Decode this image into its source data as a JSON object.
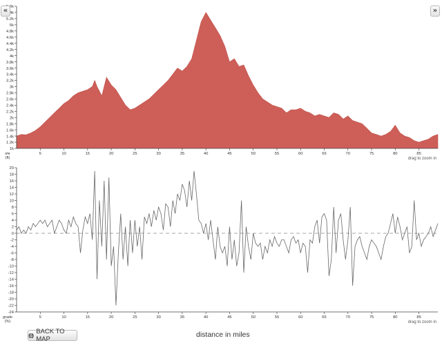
{
  "ui": {
    "collapse_left_label": "«",
    "collapse_right_label": "»",
    "back_to_map_label": "BACK TO MAP",
    "back_to_map_icon": "globe-icon",
    "x_axis_label": "distance in miles"
  },
  "chart_data": [
    {
      "type": "area",
      "ylabel_lines": [
        "ele",
        "(ft)"
      ],
      "hint": "drag to zoom in",
      "color": "#cd5f58",
      "xlim": [
        0,
        89
      ],
      "ylim": [
        1000,
        5600
      ],
      "x_ticks": [
        5,
        10,
        15,
        20,
        25,
        30,
        35,
        40,
        45,
        50,
        55,
        60,
        65,
        70,
        75,
        80,
        85
      ],
      "y_ticks": [
        1000,
        1200,
        1400,
        1600,
        1800,
        2000,
        2200,
        2400,
        2600,
        2800,
        3000,
        3200,
        3400,
        3600,
        3800,
        4000,
        4200,
        4400,
        4600,
        4800,
        5000,
        5200,
        5400,
        5600
      ],
      "y_tick_labels": [
        "1k",
        "1.2k",
        "1.4k",
        "1.6k",
        "1.8k",
        "2k",
        "2.2k",
        "2.4k",
        "2.6k",
        "2.8k",
        "3k",
        "3.2k",
        "3.4k",
        "3.6k",
        "3.8k",
        "4k",
        "4.2k",
        "4.4k",
        "4.6k",
        "4.8k",
        "5k",
        "5.2k",
        "5.4k",
        "5.6k"
      ],
      "x": [
        0,
        1,
        2,
        3,
        4,
        5,
        6,
        7,
        8,
        9,
        10,
        11,
        12,
        13,
        14,
        15,
        16,
        16.5,
        17,
        18,
        19,
        20,
        21,
        22,
        23,
        24,
        25,
        26,
        27,
        28,
        29,
        30,
        31,
        32,
        33,
        34,
        35,
        36,
        37,
        38,
        39,
        40,
        41,
        42,
        43,
        44,
        45,
        46,
        47,
        48,
        49,
        50,
        51,
        52,
        53,
        54,
        55,
        56,
        57,
        58,
        59,
        60,
        61,
        62,
        63,
        64,
        65,
        66,
        67,
        68,
        69,
        70,
        71,
        72,
        73,
        74,
        75,
        76,
        77,
        78,
        79,
        80,
        81,
        82,
        83,
        84,
        85,
        86,
        87,
        88,
        89
      ],
      "y": [
        1400,
        1450,
        1440,
        1500,
        1580,
        1700,
        1850,
        2000,
        2150,
        2300,
        2450,
        2550,
        2700,
        2800,
        2850,
        2900,
        3000,
        3200,
        3000,
        2700,
        3300,
        3050,
        2900,
        2650,
        2400,
        2250,
        2300,
        2400,
        2500,
        2600,
        2750,
        2900,
        3050,
        3200,
        3400,
        3600,
        3500,
        3650,
        3900,
        4500,
        5100,
        5400,
        5150,
        4900,
        4650,
        4300,
        3800,
        3900,
        3650,
        3700,
        3350,
        3050,
        2800,
        2600,
        2500,
        2400,
        2350,
        2300,
        2150,
        2250,
        2250,
        2300,
        2200,
        2150,
        2050,
        2100,
        2050,
        2000,
        2150,
        2100,
        1950,
        2050,
        1900,
        1850,
        1800,
        1650,
        1500,
        1450,
        1400,
        1450,
        1550,
        1750,
        1500,
        1400,
        1350,
        1250,
        1200,
        1250,
        1300,
        1400,
        1450
      ]
    },
    {
      "type": "line",
      "ylabel_lines": [
        "grade",
        "(%)"
      ],
      "hint": "drag to zoom in",
      "color": "#666666",
      "zero_line": "dashed",
      "xlim": [
        0,
        89
      ],
      "ylim": [
        -24,
        20
      ],
      "x_ticks": [
        5,
        10,
        15,
        20,
        25,
        30,
        35,
        40,
        45,
        50,
        55,
        60,
        65,
        70,
        75,
        80,
        85
      ],
      "y_ticks": [
        -24,
        -22,
        -20,
        -18,
        -16,
        -14,
        -12,
        -10,
        -8,
        -6,
        -4,
        -2,
        0,
        2,
        4,
        6,
        8,
        10,
        12,
        14,
        16,
        18,
        20
      ],
      "x": [
        0,
        0.5,
        1,
        1.5,
        2,
        2.5,
        3,
        3.5,
        4,
        4.5,
        5,
        5.5,
        6,
        6.5,
        7,
        7.5,
        8,
        8.5,
        9,
        9.5,
        10,
        10.5,
        11,
        11.5,
        12,
        12.5,
        13,
        13.5,
        14,
        14.5,
        15,
        15.5,
        16,
        16.5,
        17,
        17.5,
        18,
        18.5,
        19,
        19.5,
        20,
        20.5,
        21,
        21.5,
        22,
        22.5,
        23,
        23.5,
        24,
        24.5,
        25,
        25.5,
        26,
        26.5,
        27,
        27.5,
        28,
        28.5,
        29,
        29.5,
        30,
        30.5,
        31,
        31.5,
        32,
        32.5,
        33,
        33.5,
        34,
        34.5,
        35,
        35.5,
        36,
        36.5,
        37,
        37.5,
        38,
        38.5,
        39,
        39.5,
        40,
        40.5,
        41,
        41.5,
        42,
        42.5,
        43,
        43.5,
        44,
        44.5,
        45,
        45.5,
        46,
        46.5,
        47,
        47.5,
        48,
        48.5,
        49,
        49.5,
        50,
        50.5,
        51,
        51.5,
        52,
        52.5,
        53,
        53.5,
        54,
        54.5,
        55,
        55.5,
        56,
        56.5,
        57,
        57.5,
        58,
        58.5,
        59,
        59.5,
        60,
        60.5,
        61,
        61.5,
        62,
        62.5,
        63,
        63.5,
        64,
        64.5,
        65,
        65.5,
        66,
        66.5,
        67,
        67.5,
        68,
        68.5,
        69,
        69.5,
        70,
        70.5,
        71,
        71.5,
        72,
        72.5,
        73,
        73.5,
        74,
        74.5,
        75,
        75.5,
        76,
        76.5,
        77,
        77.5,
        78,
        78.5,
        79,
        79.5,
        80,
        80.5,
        81,
        81.5,
        82,
        82.5,
        83,
        83.5,
        84,
        84.5,
        85,
        85.5,
        86,
        86.5,
        87,
        87.5,
        88,
        88.5,
        89
      ],
      "y": [
        1,
        2,
        0,
        1,
        0,
        2,
        1,
        3,
        2,
        3,
        4,
        3,
        4,
        2,
        3,
        4,
        0,
        2,
        4,
        3,
        1,
        0,
        4,
        2,
        5,
        3,
        2,
        -6,
        1,
        5,
        3,
        6,
        -2,
        19,
        -14,
        10,
        -4,
        16,
        -8,
        17,
        -10,
        -4,
        -22,
        -6,
        6,
        -8,
        2,
        -10,
        4,
        -6,
        4,
        -4,
        2,
        -8,
        5,
        3,
        6,
        2,
        7,
        4,
        8,
        6,
        1,
        9,
        8,
        2,
        10,
        6,
        12,
        10,
        15,
        13,
        8,
        16,
        10,
        19,
        12,
        4,
        3,
        0,
        3,
        -2,
        4,
        -2,
        -8,
        2,
        -4,
        -6,
        -4,
        -10,
        2,
        -8,
        -2,
        -10,
        -6,
        10,
        -12,
        2,
        -4,
        -8,
        0,
        -3,
        -4,
        -3,
        -8,
        -4,
        -6,
        -2,
        -4,
        -1,
        -3,
        -4,
        -2,
        -2,
        -4,
        -6,
        -2,
        -1,
        -3,
        -2,
        -6,
        -3,
        -4,
        -12,
        -2,
        -3,
        2,
        4,
        -3,
        5,
        6,
        4,
        -13,
        -8,
        8,
        -6,
        4,
        6,
        -2,
        -8,
        -2,
        8,
        -16,
        -4,
        -2,
        -1,
        -4,
        -6,
        -8,
        -4,
        -2,
        -3,
        -4,
        -6,
        -8,
        -4,
        -1,
        0,
        3,
        6,
        0,
        5,
        2,
        -2,
        0,
        2,
        -6,
        -4,
        10,
        -2,
        0,
        -4,
        -2,
        -1,
        0,
        2,
        -1,
        1,
        3,
        1,
        2,
        0,
        1
      ]
    }
  ]
}
